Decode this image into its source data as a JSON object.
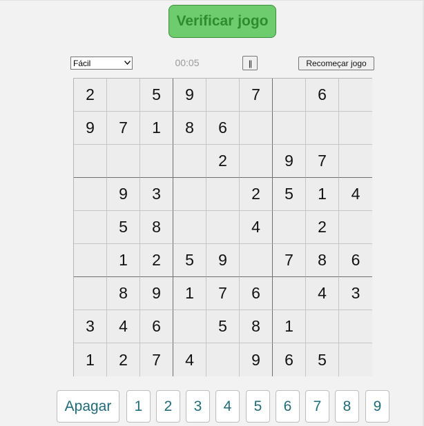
{
  "header": {
    "check_label": "Verificar jogo"
  },
  "controls": {
    "difficulty_selected": "Fácil",
    "timer": "00:05",
    "pause_label": "||",
    "restart_label": "Recomeçar jogo"
  },
  "board": [
    [
      "2",
      "",
      "5",
      "9",
      "",
      "7",
      "",
      "6",
      ""
    ],
    [
      "9",
      "7",
      "1",
      "8",
      "6",
      "",
      "",
      "",
      ""
    ],
    [
      "",
      "",
      "",
      "",
      "2",
      "",
      "9",
      "7",
      ""
    ],
    [
      "",
      "9",
      "3",
      "",
      "",
      "2",
      "5",
      "1",
      "4"
    ],
    [
      "",
      "5",
      "8",
      "",
      "",
      "4",
      "",
      "2",
      ""
    ],
    [
      "",
      "1",
      "2",
      "5",
      "9",
      "",
      "7",
      "8",
      "6"
    ],
    [
      "",
      "8",
      "9",
      "1",
      "7",
      "6",
      "",
      "4",
      "3"
    ],
    [
      "3",
      "4",
      "6",
      "",
      "5",
      "8",
      "1",
      "",
      ""
    ],
    [
      "1",
      "2",
      "7",
      "4",
      "",
      "9",
      "6",
      "5",
      ""
    ]
  ],
  "numpad": {
    "erase_label": "Apagar",
    "digits": [
      "1",
      "2",
      "3",
      "4",
      "5",
      "6",
      "7",
      "8",
      "9"
    ]
  },
  "colors": {
    "check_button": "#6ecb6e",
    "check_text": "#2e8b2e",
    "numpad_text": "#1f6b78",
    "cell_background": "#ededed"
  }
}
